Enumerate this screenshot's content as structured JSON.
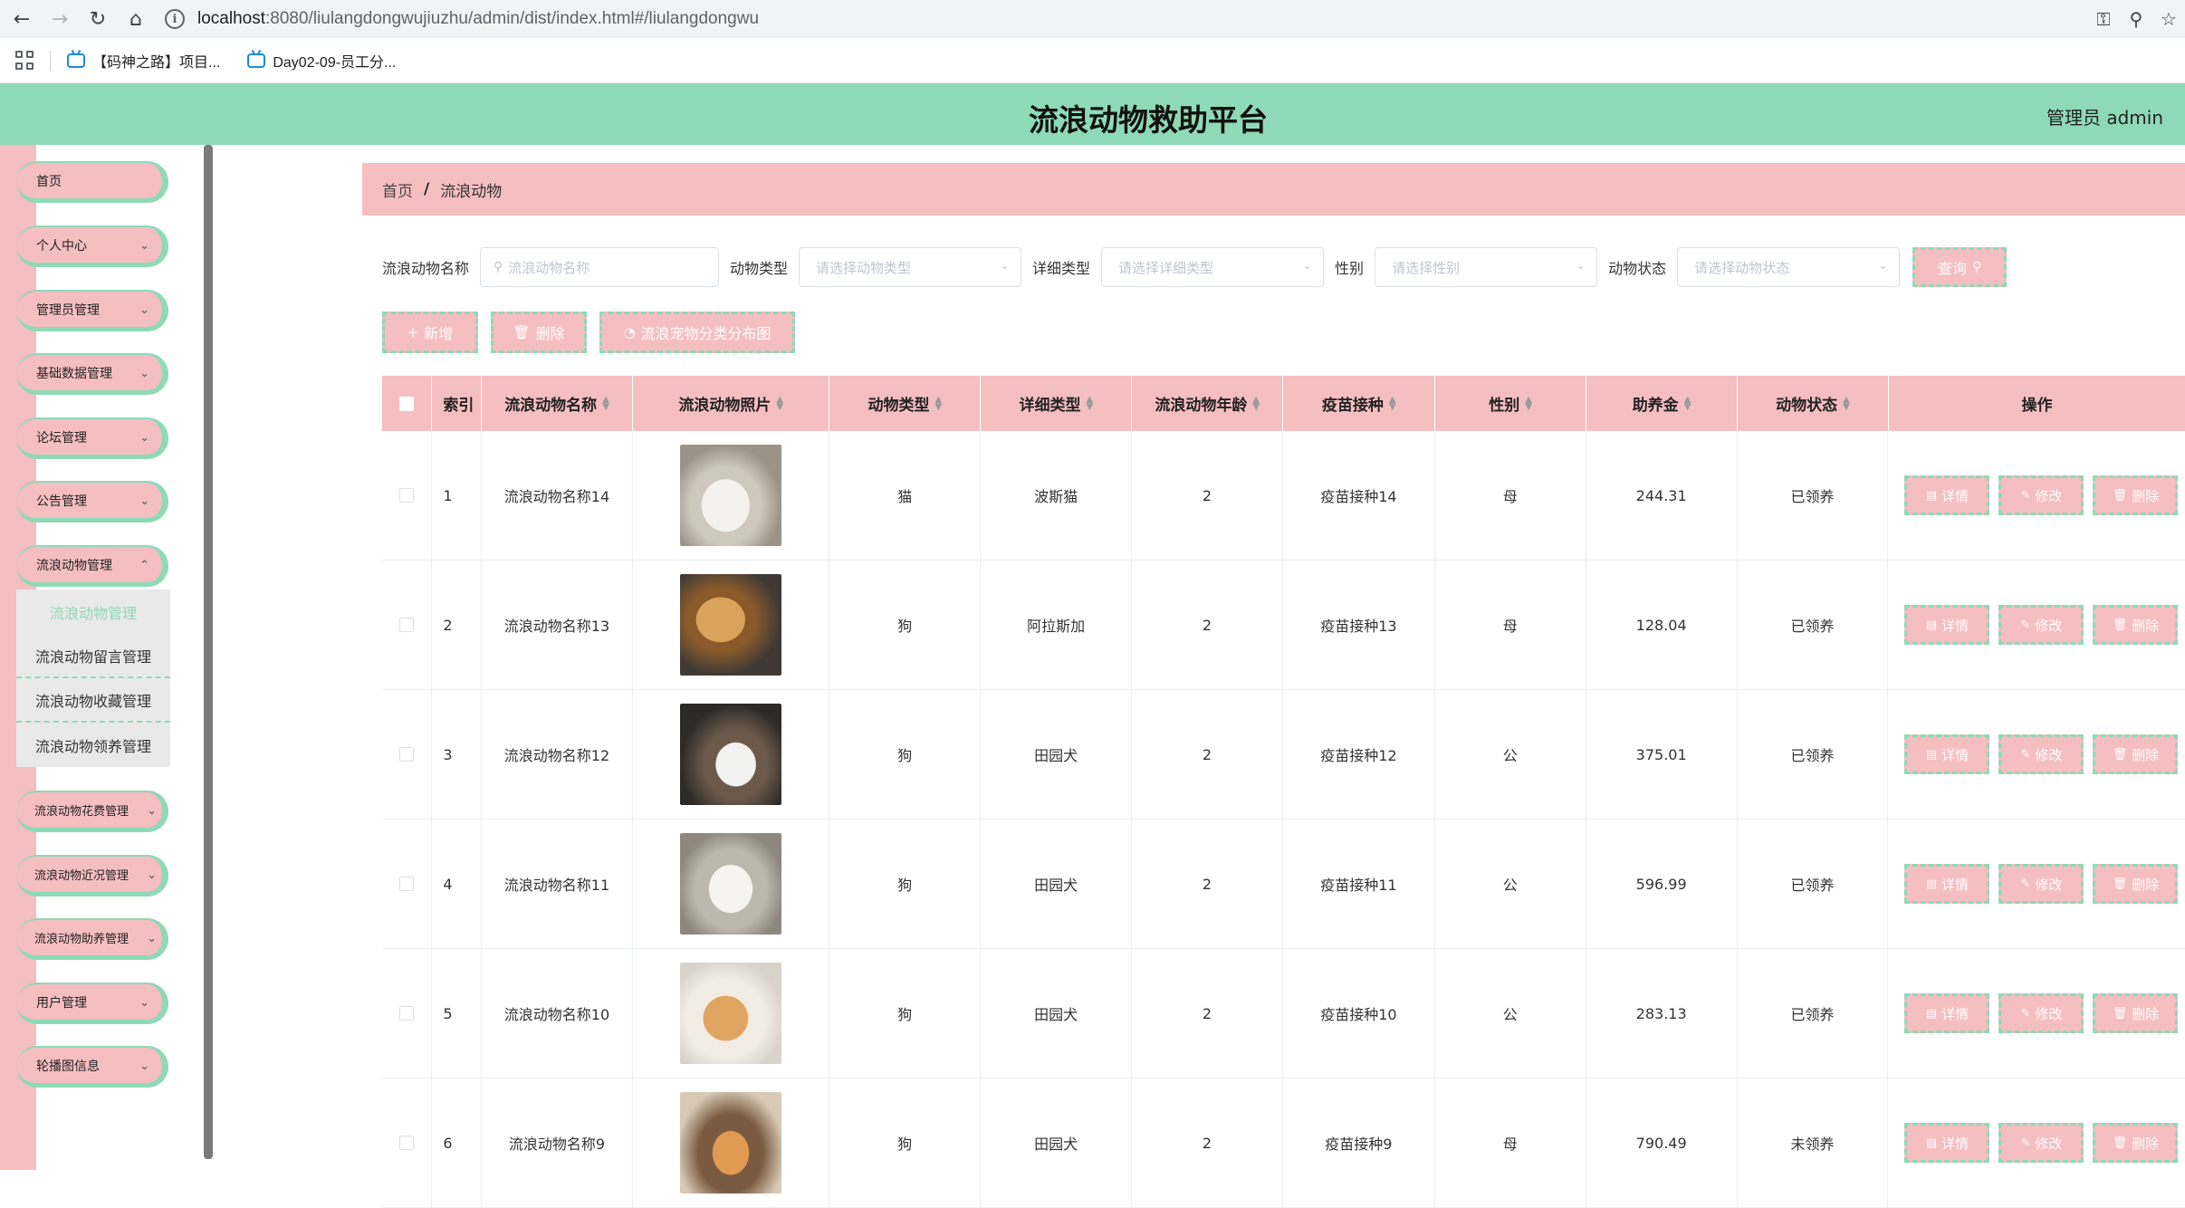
{
  "browser": {
    "url_host": "localhost",
    "url_rest": ":8080/liulangdongwujiuzhu/admin/dist/index.html#/liulangdongwu",
    "bookmarks": [
      "【码神之路】项目...",
      "Day02-09-员工分..."
    ]
  },
  "header": {
    "title": "流浪动物救助平台",
    "user": "管理员 admin"
  },
  "sidebar": {
    "items": [
      {
        "label": "首页",
        "has_children": false
      },
      {
        "label": "个人中心",
        "has_children": true
      },
      {
        "label": "管理员管理",
        "has_children": true
      },
      {
        "label": "基础数据管理",
        "has_children": true
      },
      {
        "label": "论坛管理",
        "has_children": true
      },
      {
        "label": "公告管理",
        "has_children": true
      },
      {
        "label": "流浪动物管理",
        "has_children": true
      }
    ],
    "submenu": [
      "流浪动物管理",
      "流浪动物留言管理",
      "流浪动物收藏管理",
      "流浪动物领养管理"
    ],
    "items_after": [
      {
        "label": "流浪动物花费管理"
      },
      {
        "label": "流浪动物近况管理"
      },
      {
        "label": "流浪动物助养管理"
      },
      {
        "label": "用户管理"
      },
      {
        "label": "轮播图信息"
      }
    ]
  },
  "breadcrumb": {
    "home": "首页",
    "separator": "/",
    "current": "流浪动物"
  },
  "filters": {
    "name_label": "流浪动物名称",
    "name_placeholder": "流浪动物名称",
    "type_label": "动物类型",
    "type_placeholder": "请选择动物类型",
    "detail_label": "详细类型",
    "detail_placeholder": "请选择详细类型",
    "sex_label": "性别",
    "sex_placeholder": "请选择性别",
    "status_label": "动物状态",
    "status_placeholder": "请选择动物状态",
    "query_label": "查询"
  },
  "actions": {
    "add": "新增",
    "delete": "删除",
    "chart": "流浪宠物分类分布图"
  },
  "table": {
    "headers": {
      "index": "索引",
      "name": "流浪动物名称",
      "photo": "流浪动物照片",
      "type": "动物类型",
      "detail": "详细类型",
      "age": "流浪动物年龄",
      "vaccine": "疫苗接种",
      "sex": "性别",
      "fund": "助养金",
      "status": "动物状态",
      "ops": "操作"
    },
    "op_labels": {
      "detail": "详情",
      "edit": "修改",
      "delete": "删除"
    },
    "rows": [
      {
        "index": "1",
        "name": "流浪动物名称14",
        "type": "猫",
        "detail": "波斯猫",
        "age": "2",
        "vaccine": "疫苗接种14",
        "sex": "母",
        "fund": "244.31",
        "status": "已领养"
      },
      {
        "index": "2",
        "name": "流浪动物名称13",
        "type": "狗",
        "detail": "阿拉斯加",
        "age": "2",
        "vaccine": "疫苗接种13",
        "sex": "母",
        "fund": "128.04",
        "status": "已领养"
      },
      {
        "index": "3",
        "name": "流浪动物名称12",
        "type": "狗",
        "detail": "田园犬",
        "age": "2",
        "vaccine": "疫苗接种12",
        "sex": "公",
        "fund": "375.01",
        "status": "已领养"
      },
      {
        "index": "4",
        "name": "流浪动物名称11",
        "type": "狗",
        "detail": "田园犬",
        "age": "2",
        "vaccine": "疫苗接种11",
        "sex": "公",
        "fund": "596.99",
        "status": "已领养"
      },
      {
        "index": "5",
        "name": "流浪动物名称10",
        "type": "狗",
        "detail": "田园犬",
        "age": "2",
        "vaccine": "疫苗接种10",
        "sex": "公",
        "fund": "283.13",
        "status": "已领养"
      },
      {
        "index": "6",
        "name": "流浪动物名称9",
        "type": "狗",
        "detail": "田园犬",
        "age": "2",
        "vaccine": "疫苗接种9",
        "sex": "母",
        "fund": "790.49",
        "status": "未领养"
      }
    ]
  },
  "colors": {
    "accent_green": "#8fdab6",
    "accent_pink": "#f5bec0"
  }
}
